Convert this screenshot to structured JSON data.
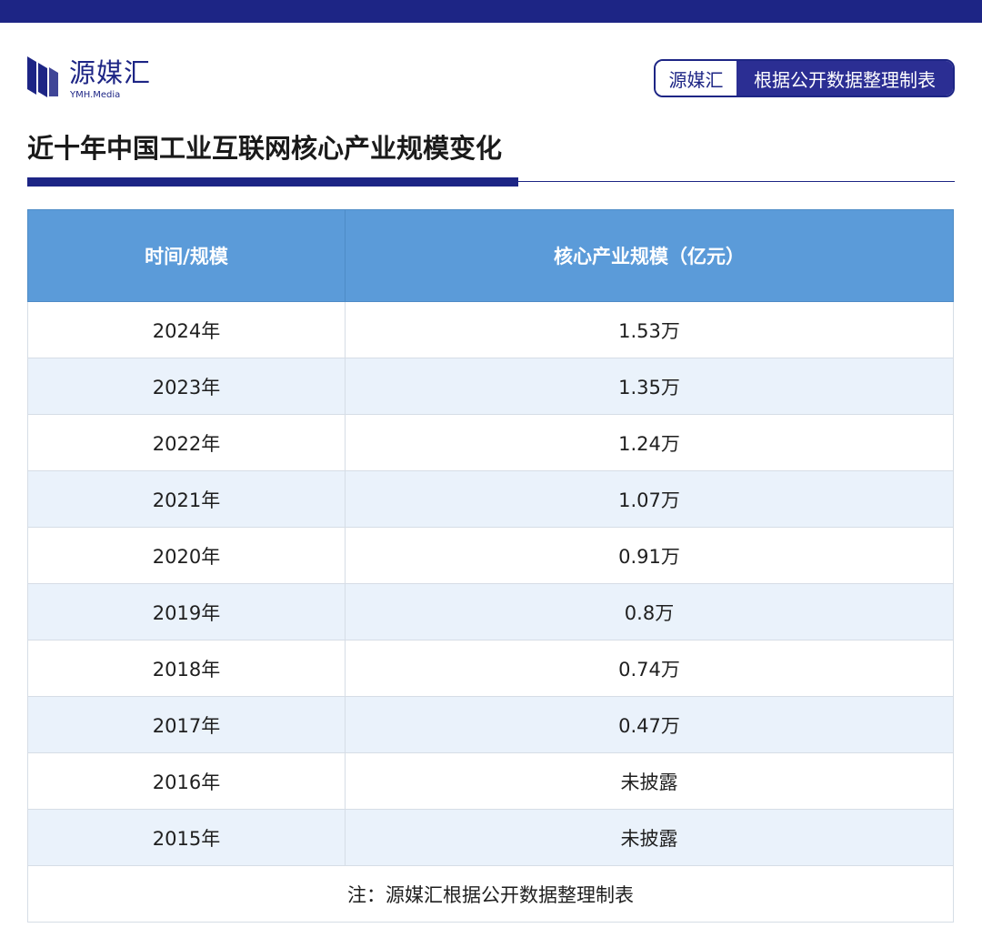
{
  "header": {
    "logo_text": "源媒汇",
    "logo_sub": "YMH.Media",
    "source_tag": {
      "brand": "源媒汇",
      "description": "根据公开数据整理制表"
    }
  },
  "title": "近十年中国工业互联网核心产业规模变化",
  "table": {
    "columns": [
      "时间/规模",
      "核心产业规模（亿元）"
    ],
    "rows": [
      {
        "year": "2024年",
        "value": "1.53万"
      },
      {
        "year": "2023年",
        "value": "1.35万"
      },
      {
        "year": "2022年",
        "value": "1.24万"
      },
      {
        "year": "2021年",
        "value": "1.07万"
      },
      {
        "year": "2020年",
        "value": "0.91万"
      },
      {
        "year": "2019年",
        "value": "0.8万"
      },
      {
        "year": "2018年",
        "value": "0.74万"
      },
      {
        "year": "2017年",
        "value": "0.47万"
      },
      {
        "year": "2016年",
        "value": "未披露"
      },
      {
        "year": "2015年",
        "value": "未披露"
      }
    ],
    "note": "注：源媒汇根据公开数据整理制表"
  },
  "colors": {
    "brand_navy": "#1d2585",
    "header_blue": "#5b9bd9",
    "stripe_blue": "#eaf2fb"
  }
}
